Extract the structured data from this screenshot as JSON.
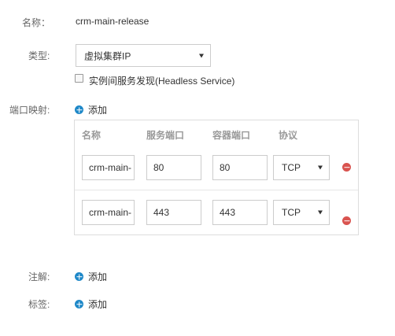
{
  "form": {
    "name_label": "名称：",
    "name_value": "crm-main-release",
    "type_label": "类型:",
    "type_value": "虚拟集群IP",
    "headless_label": "实例间服务发现(Headless Service)",
    "port_mapping_label": "端口映射:",
    "add_label": "添加",
    "annotation_label": "注解:",
    "tags_label": "标签:"
  },
  "port_table": {
    "headers": [
      "名称",
      "服务端口",
      "容器端口",
      "协议"
    ],
    "rows": [
      {
        "name": "crm-main-",
        "service_port": "80",
        "container_port": "80",
        "protocol": "TCP"
      },
      {
        "name": "crm-main-",
        "service_port": "443",
        "container_port": "443",
        "protocol": "TCP"
      }
    ]
  },
  "colors": {
    "add_icon": "#1e88c8",
    "remove_icon": "#d9534f"
  }
}
